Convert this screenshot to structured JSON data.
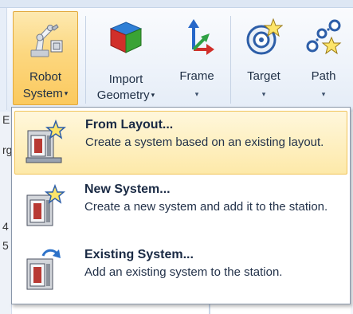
{
  "ribbon": {
    "buttons": [
      {
        "line1": "Robot",
        "line2": "System",
        "has_dropdown": true,
        "icon": "robot-arm-icon",
        "active": true
      },
      {
        "line1": "Import",
        "line2": "Geometry",
        "has_dropdown": true,
        "icon": "geometry-cube-icon"
      },
      {
        "line1": "Frame",
        "line2": "",
        "has_dropdown": true,
        "icon": "frame-axes-icon"
      },
      {
        "line1": "Target",
        "line2": "",
        "has_dropdown": true,
        "icon": "target-icon"
      },
      {
        "line1": "Path",
        "line2": "",
        "has_dropdown": true,
        "icon": "path-icon"
      }
    ],
    "dropdown_arrow": "▾"
  },
  "left_strip": {
    "chars": [
      "E",
      "rg",
      "4",
      "5"
    ]
  },
  "menu": {
    "items": [
      {
        "title": "From Layout...",
        "description": "Create a system based on an existing layout.",
        "icon": "system-from-layout-icon",
        "highlighted": true
      },
      {
        "title": "New System...",
        "description": "Create a new system and add it to the station.",
        "icon": "new-system-icon",
        "highlighted": false
      },
      {
        "title": "Existing System...",
        "description": "Add an existing system to the station.",
        "icon": "existing-system-icon",
        "highlighted": false
      }
    ]
  },
  "colors": {
    "active_button": "#fbc95e",
    "highlight_item": "#fde9a9",
    "menu_border": "#8a97aa",
    "ribbon_bg": "#eef3fa"
  }
}
